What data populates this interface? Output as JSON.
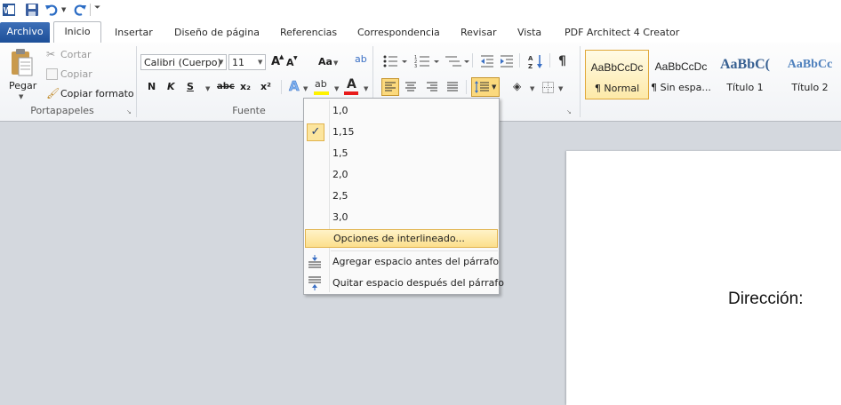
{
  "quick_access": {
    "icons": [
      "word-icon",
      "save-icon",
      "undo-icon",
      "redo-icon",
      "customize-icon"
    ]
  },
  "tabs": [
    "Archivo",
    "Inicio",
    "Insertar",
    "Diseño de página",
    "Referencias",
    "Correspondencia",
    "Revisar",
    "Vista",
    "PDF Architect 4 Creator"
  ],
  "clipboard": {
    "paste": "Pegar",
    "cut": "Cortar",
    "copy": "Copiar",
    "format_painter": "Copiar formato",
    "group": "Portapapeles"
  },
  "font": {
    "name": "Calibri (Cuerpo)",
    "size": "11",
    "group": "Fuente",
    "grow": "A",
    "shrink": "A",
    "case": "Aa",
    "bold": "N",
    "italic": "K",
    "underline": "S",
    "strike": "abc",
    "subscript": "x₂",
    "superscript": "x²"
  },
  "styles": [
    {
      "sample": "AaBbCcDc",
      "name": "¶ Normal",
      "selected": true
    },
    {
      "sample": "AaBbCcDc",
      "name": "¶ Sin espa...",
      "selected": false
    },
    {
      "sample": "AaBbC(",
      "name": "Título 1",
      "selected": false
    },
    {
      "sample": "AaBbCc",
      "name": "Título 2",
      "selected": false
    }
  ],
  "line_spacing_menu": {
    "options": [
      "1,0",
      "1,15",
      "1,5",
      "2,0",
      "2,5",
      "3,0"
    ],
    "checked": "1,15",
    "spacing_options": "Opciones de interlineado...",
    "add_before": "Agregar espacio antes del párrafo",
    "remove_after": "Quitar espacio después del párrafo"
  },
  "document": {
    "text": "Dirección:"
  },
  "colors": {
    "archivo_tab": "#2b579a",
    "highlight": "#fff200",
    "font_color": "#e81b1b",
    "menu_hover": "#fce59e"
  }
}
